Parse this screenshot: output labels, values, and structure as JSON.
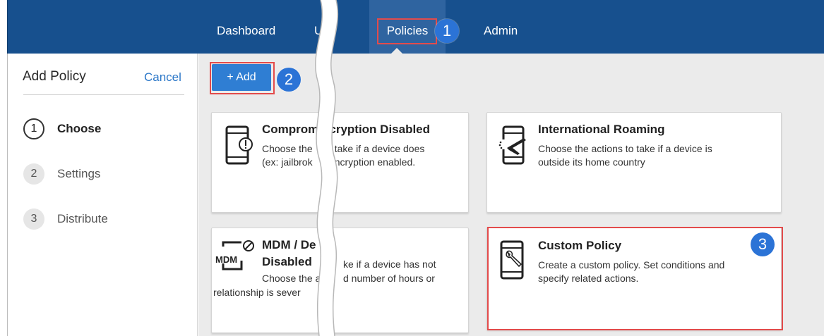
{
  "nav": {
    "items": [
      "Dashboard",
      "U",
      "Policies",
      "Admin"
    ]
  },
  "callouts": [
    "1",
    "2",
    "3"
  ],
  "left_panel": {
    "title": "Add Policy",
    "cancel_label": "Cancel",
    "steps": [
      {
        "num": "1",
        "label": "Choose",
        "active": true
      },
      {
        "num": "2",
        "label": "Settings",
        "active": false
      },
      {
        "num": "3",
        "label": "Distribute",
        "active": false
      }
    ]
  },
  "toolbar": {
    "add_label": "+ Add"
  },
  "cards": [
    {
      "icon": "compromised-phone-icon",
      "title": "Comprom     ncryption Disabled",
      "desc_line1": "Choose the        take if a device does",
      "desc_line2": "(ex: jailbrok      encryption enabled."
    },
    {
      "icon": "phone-airplane-icon",
      "title": "International Roaming",
      "desc_line1": "Choose the actions to take if a device is",
      "desc_line2": "outside its home country"
    },
    {
      "icon": "mdm-disabled-icon",
      "icon_text": "MDM",
      "title_line1": "MDM / De",
      "title_line2": "Disabled",
      "desc_line1": "ke if a device has not",
      "desc_line2": "Choose the a",
      "desc_line2b": "d number of hours or",
      "desc_line3": "relationship is sever"
    },
    {
      "icon": "phone-wrench-icon",
      "title": "Custom Policy",
      "desc_line1": "Create a custom policy. Set conditions and",
      "desc_line2": "specify related actions."
    }
  ],
  "colors": {
    "nav_bg": "#17508e",
    "nav_active_bg": "#2f64a0",
    "accent_blue": "#2f7ed3",
    "badge_blue": "#2b73d6",
    "highlight_red": "#e34b4b",
    "main_bg": "#ebebeb"
  }
}
